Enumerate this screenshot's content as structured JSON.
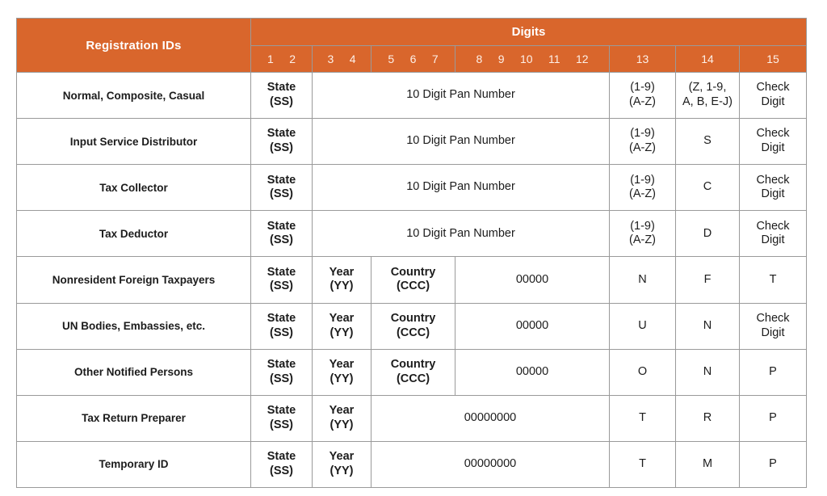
{
  "table": {
    "header": {
      "registration_ids": "Registration IDs",
      "digits": "Digits",
      "digit_numbers": [
        "1",
        "2",
        "3",
        "4",
        "5",
        "6",
        "7",
        "8",
        "9",
        "10",
        "11",
        "12",
        "13",
        "14",
        "15"
      ]
    },
    "common": {
      "state_line1": "State",
      "state_line2": "(SS)",
      "year_line1": "Year",
      "year_line2": "(YY)",
      "country_line1": "Country",
      "country_line2": "(CCC)",
      "pan": "10 Digit Pan Number",
      "zeros5": "00000",
      "zeros8": "00000000",
      "check_line1": "Check",
      "check_line2": "Digit",
      "d13_line1": "(1-9)",
      "d13_line2": "(A-Z)"
    },
    "rows": [
      {
        "label": "Normal, Composite, Casual",
        "layout": "pan",
        "d13_line1": "(1-9)",
        "d13_line2": "(A-Z)",
        "d14_line1": "(Z, 1-9,",
        "d14_line2": "A, B, E-J)",
        "d15_line1": "Check",
        "d15_line2": "Digit"
      },
      {
        "label": "Input Service Distributor",
        "layout": "pan",
        "d13_line1": "(1-9)",
        "d13_line2": "(A-Z)",
        "d14_line1": "S",
        "d14_line2": "",
        "d15_line1": "Check",
        "d15_line2": "Digit"
      },
      {
        "label": "Tax Collector",
        "layout": "pan",
        "d13_line1": "(1-9)",
        "d13_line2": "(A-Z)",
        "d14_line1": "C",
        "d14_line2": "",
        "d15_line1": "Check",
        "d15_line2": "Digit"
      },
      {
        "label": "Tax Deductor",
        "layout": "pan",
        "d13_line1": "(1-9)",
        "d13_line2": "(A-Z)",
        "d14_line1": "D",
        "d14_line2": "",
        "d15_line1": "Check",
        "d15_line2": "Digit"
      },
      {
        "label": "Nonresident Foreign Taxpayers",
        "layout": "country",
        "zeros": "00000",
        "d13_line1": "N",
        "d13_line2": "",
        "d14_line1": "F",
        "d14_line2": "",
        "d15_line1": "T",
        "d15_line2": ""
      },
      {
        "label": "UN Bodies, Embassies, etc.",
        "layout": "country",
        "zeros": "00000",
        "d13_line1": "U",
        "d13_line2": "",
        "d14_line1": "N",
        "d14_line2": "",
        "d15_line1": "Check",
        "d15_line2": "Digit"
      },
      {
        "label": "Other Notified Persons",
        "layout": "country",
        "zeros": "00000",
        "d13_line1": "O",
        "d13_line2": "",
        "d14_line1": "N",
        "d14_line2": "",
        "d15_line1": "P",
        "d15_line2": ""
      },
      {
        "label": "Tax Return Preparer",
        "layout": "pink",
        "zeros": "00000000",
        "d13_line1": "T",
        "d13_line2": "",
        "d14_line1": "R",
        "d14_line2": "",
        "d15_line1": "P",
        "d15_line2": ""
      },
      {
        "label": "Temporary ID",
        "layout": "pink",
        "zeros": "00000000",
        "d13_line1": "T",
        "d13_line2": "",
        "d14_line1": "M",
        "d14_line2": "",
        "d15_line1": "P",
        "d15_line2": ""
      }
    ]
  },
  "colors": {
    "header_orange": "#d9662c",
    "state_yellow": "#fbf2bf",
    "year_peach": "#fdf0e0",
    "country_blue": "#d6ecfa",
    "pan_blue": "#dde7f8",
    "zeros_green": "#f2f8e2",
    "pink": "#f7c9b6",
    "border_gray": "#9a9a9a"
  }
}
